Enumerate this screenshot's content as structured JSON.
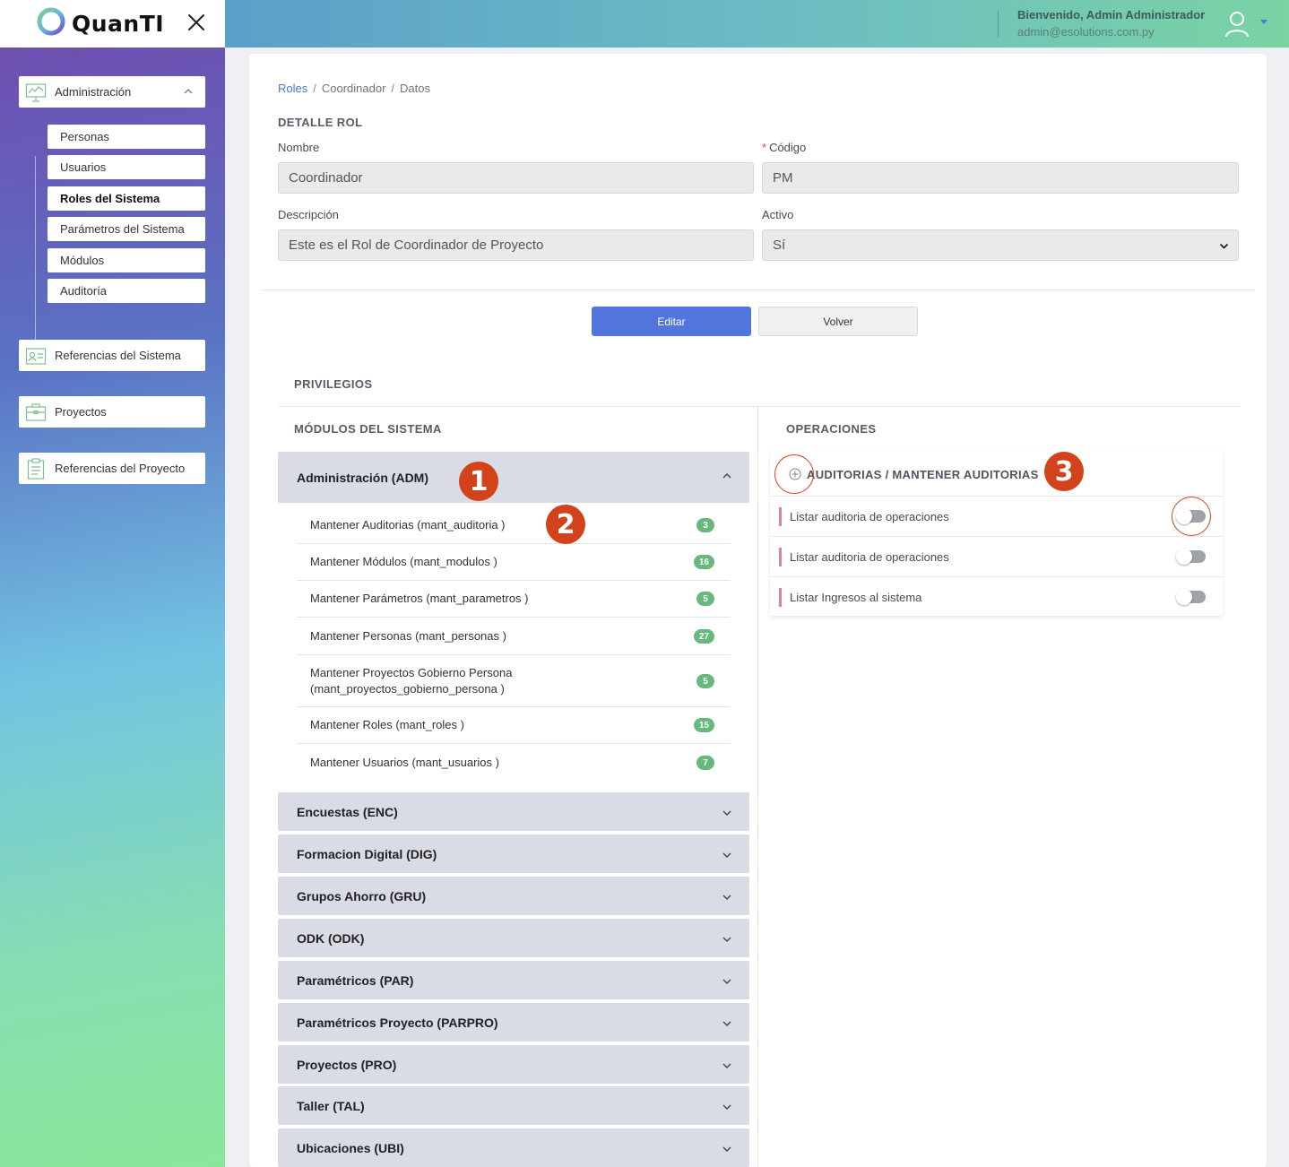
{
  "app": {
    "logo_text": "QuanTI"
  },
  "header": {
    "welcome": "Bienvenido, Admin Administrador",
    "email": "admin@esolutions.com.py"
  },
  "sidebar": {
    "groups": [
      {
        "label": "Administración"
      },
      {
        "label": "Referencias del Sistema"
      },
      {
        "label": "Proyectos"
      },
      {
        "label": "Referencias del Proyecto"
      }
    ],
    "items": [
      {
        "label": "Personas"
      },
      {
        "label": "Usuarios"
      },
      {
        "label": "Roles del Sistema",
        "active": true
      },
      {
        "label": "Parámetros del Sistema"
      },
      {
        "label": "Módulos"
      },
      {
        "label": "Auditoría"
      }
    ]
  },
  "breadcrumb": [
    "Roles",
    "Coordinador",
    "Datos"
  ],
  "detail": {
    "section_title": "DETALLE ROL",
    "nombre_label": "Nombre",
    "nombre_value": "Coordinador",
    "codigo_label": "Código",
    "codigo_required": "*",
    "codigo_value": "PM",
    "descripcion_label": "Descripción",
    "descripcion_value": "Este es el Rol de Coordinador de Proyecto",
    "activo_label": "Activo",
    "activo_value": "Sí"
  },
  "buttons": {
    "edit": "Editar",
    "back": "Volver"
  },
  "privileges": {
    "title": "PRIVILEGIOS",
    "modules_title": "MÓDULOS DEL SISTEMA",
    "operations_title": "OPERACIONES",
    "expanded_module": "Administración (ADM)",
    "submodules": [
      {
        "label": "Mantener Auditorias (mant_auditoria )",
        "count": "3"
      },
      {
        "label": "Mantener Módulos (mant_modulos )",
        "count": "16"
      },
      {
        "label": "Mantener Parámetros (mant_parametros )",
        "count": "5"
      },
      {
        "label": "Mantener Personas (mant_personas )",
        "count": "27"
      },
      {
        "label": "Mantener Proyectos Gobierno Persona (mant_proyectos_gobierno_persona )",
        "count": "5"
      },
      {
        "label": "Mantener Roles (mant_roles )",
        "count": "15"
      },
      {
        "label": "Mantener Usuarios (mant_usuarios )",
        "count": "7"
      }
    ],
    "collapsed_modules": [
      "Encuestas (ENC)",
      "Formacion Digital (DIG)",
      "Grupos Ahorro (GRU)",
      "ODK (ODK)",
      "Paramétricos (PAR)",
      "Paramétricos Proyecto (PARPRO)",
      "Proyectos (PRO)",
      "Taller (TAL)",
      "Ubicaciones (UBI)"
    ],
    "operations_group": "AUDITORIAS / MANTENER AUDITORIAS",
    "operations": [
      {
        "label": "Listar auditoria de operaciones",
        "enabled": false
      },
      {
        "label": "Listar auditoria de operaciones",
        "enabled": false
      },
      {
        "label": "Listar Ingresos al sistema",
        "enabled": false
      }
    ]
  },
  "annotations": [
    "1",
    "2",
    "3"
  ],
  "colors": {
    "primary": "#5175dc",
    "badge": "#67b87d",
    "annotation": "#d2431c",
    "module_header": "#d9dbe5"
  }
}
